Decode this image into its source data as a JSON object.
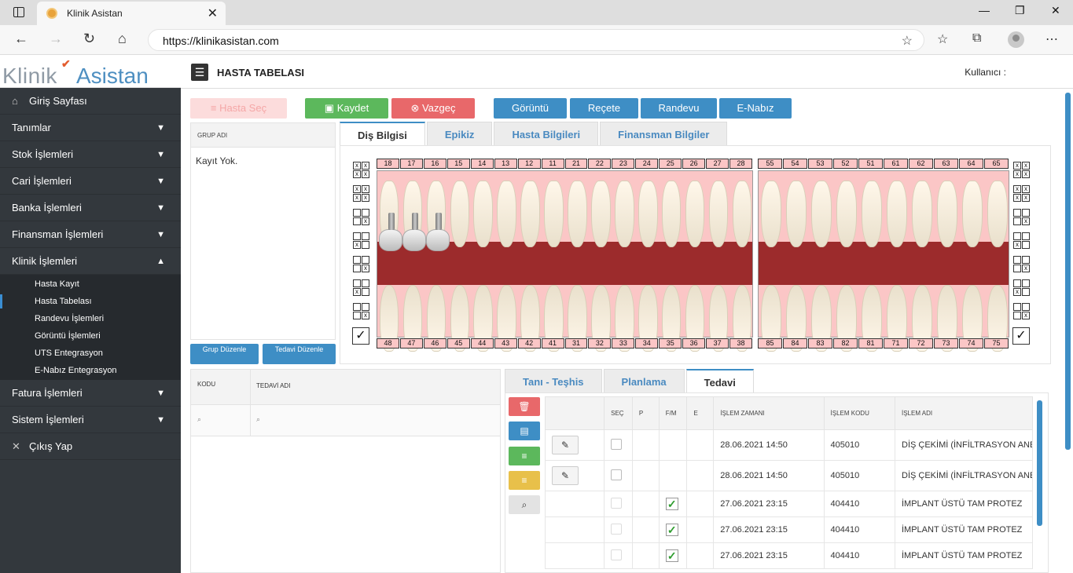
{
  "browser": {
    "tab_title": "Klinik Asistan",
    "url": "https://klinikasistan.com"
  },
  "logo": {
    "part1": "Klinik",
    "part2": "Asistan"
  },
  "sidebar": {
    "items": [
      {
        "label": "Giriş Sayfası"
      },
      {
        "label": "Tanımlar"
      },
      {
        "label": "Stok İşlemleri"
      },
      {
        "label": "Cari İşlemleri"
      },
      {
        "label": "Banka İşlemleri"
      },
      {
        "label": "Finansman İşlemleri"
      },
      {
        "label": "Klinik İşlemleri"
      }
    ],
    "sub_items": [
      {
        "label": "Hasta Kayıt"
      },
      {
        "label": "Hasta Tabelası"
      },
      {
        "label": "Randevu İşlemleri"
      },
      {
        "label": "Görüntü İşlemleri"
      },
      {
        "label": "UTS Entegrasyon"
      },
      {
        "label": "E-Nabız Entegrasyon"
      }
    ],
    "items_after": [
      {
        "label": "Fatura İşlemleri"
      },
      {
        "label": "Sistem İşlemleri"
      },
      {
        "label": "Çıkış Yap"
      }
    ]
  },
  "header": {
    "title": "HASTA TABELASI",
    "user": "Kullanıcı : "
  },
  "toolbar": {
    "hasta_sec": "Hasta Seç",
    "kaydet": "Kaydet",
    "vazgec": "Vazgeç",
    "goruntu": "Görüntü",
    "recete": "Reçete",
    "randevu": "Randevu",
    "enabiz": "E-Nabız"
  },
  "group_panel": {
    "header": "GRUP ADI",
    "empty": "Kayıt Yok.",
    "btn_grup": "Grup Düzenle",
    "btn_tedavi": "Tedavi Düzenle"
  },
  "tabs_top": [
    "Diş Bilgisi",
    "Epikiz",
    "Hasta Bilgileri",
    "Finansman Bilgiler"
  ],
  "teeth": {
    "upper_left": [
      "18",
      "17",
      "16",
      "15",
      "14",
      "13",
      "12",
      "11",
      "21",
      "22",
      "23",
      "24",
      "25",
      "26",
      "27",
      "28"
    ],
    "upper_right": [
      "55",
      "54",
      "53",
      "52",
      "51",
      "61",
      "62",
      "63",
      "64",
      "65"
    ],
    "lower_left": [
      "48",
      "47",
      "46",
      "45",
      "44",
      "43",
      "42",
      "41",
      "31",
      "32",
      "33",
      "34",
      "35",
      "36",
      "37",
      "38"
    ],
    "lower_right": [
      "85",
      "84",
      "83",
      "82",
      "81",
      "71",
      "72",
      "73",
      "74",
      "75"
    ],
    "mark": "x",
    "check": "✓"
  },
  "treat_panel": {
    "col1": "KODU",
    "col2": "TEDAVİ ADI"
  },
  "tabs_bottom": [
    "Tanı - Teşhis",
    "Planlama",
    "Tedavi"
  ],
  "table": {
    "headers": [
      "SEÇ",
      "P",
      "F/M",
      "E",
      "İŞLEM ZAMANI",
      "İŞLEM KODU",
      "İŞLEM ADI"
    ],
    "rows": [
      {
        "time": "28.06.2021 14:50",
        "code": "405010",
        "name": "DİŞ ÇEKİMİ (İNFİLTRASYON ANESTEZİSİ DAHİL)",
        "fm": ""
      },
      {
        "time": "28.06.2021 14:50",
        "code": "405010",
        "name": "DİŞ ÇEKİMİ (İNFİLTRASYON ANESTEZİSİ DAHİL)",
        "fm": ""
      },
      {
        "time": "27.06.2021 23:15",
        "code": "404410",
        "name": "İMPLANT ÜSTÜ TAM PROTEZ",
        "fm": "✓"
      },
      {
        "time": "27.06.2021 23:15",
        "code": "404410",
        "name": "İMPLANT ÜSTÜ TAM PROTEZ",
        "fm": "✓"
      },
      {
        "time": "27.06.2021 23:15",
        "code": "404410",
        "name": "İMPLANT ÜSTÜ TAM PROTEZ",
        "fm": "✓"
      }
    ]
  }
}
